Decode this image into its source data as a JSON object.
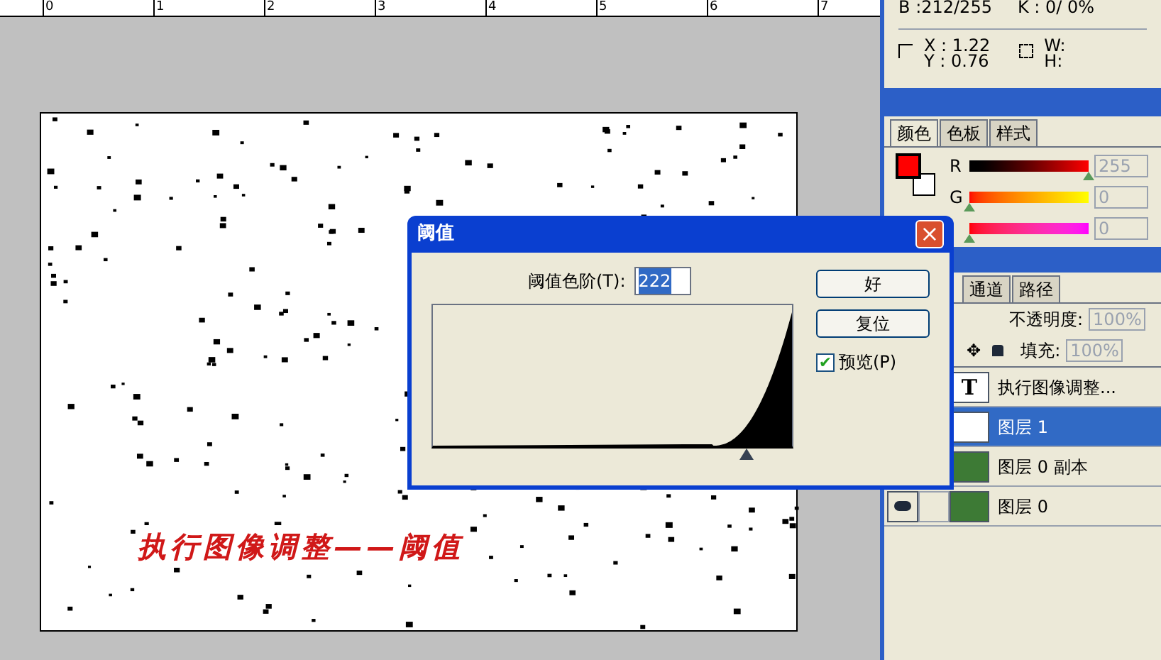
{
  "ruler": {
    "ticks": [
      "0",
      "1",
      "2",
      "3",
      "4",
      "5",
      "6",
      "7"
    ]
  },
  "canvas": {
    "caption": "执行图像调整——阈值"
  },
  "info_panel": {
    "rows": [
      {
        "label": "B",
        "value": ":212/255"
      },
      {
        "label": "K",
        "value": ":  0/  0%"
      }
    ],
    "position": {
      "x_label": "X :",
      "x_value": "1.22",
      "y_label": "Y :",
      "y_value": "0.76",
      "w_label": "W:",
      "h_label": "H:"
    }
  },
  "color_panel": {
    "tabs": [
      {
        "label": "颜色",
        "selected": true
      },
      {
        "label": "色板",
        "selected": false
      },
      {
        "label": "样式",
        "selected": false
      }
    ],
    "sliders": [
      {
        "label": "R",
        "level": 1,
        "value": "255",
        "disabled": true
      },
      {
        "label": "G",
        "level": 0,
        "value": "0",
        "disabled": true
      },
      {
        "level": 0,
        "value": "0",
        "disabled": true
      }
    ]
  },
  "layers_panel": {
    "tabs": [
      {
        "label": "通道",
        "selected": false
      },
      {
        "label": "路径",
        "selected": false
      }
    ],
    "opacity_label": "不透明度:",
    "opacity": "100%",
    "move_glyph": "✥",
    "fill_label": "填充:",
    "fill": "100%",
    "layers": [
      {
        "name": "执行图像调整...",
        "kind": "text",
        "thumb_glyph": "T",
        "selected": false
      },
      {
        "name": "图层 1",
        "kind": "blank",
        "selected": true
      },
      {
        "name": "图层 0 副本",
        "kind": "photo",
        "selected": false
      },
      {
        "name": "图层 0",
        "kind": "photo",
        "selected": false,
        "visible": true
      }
    ]
  },
  "dialog": {
    "title": "阈值",
    "close": "×",
    "level_label": "阈值色阶(T):",
    "level_value": "222",
    "slider": {
      "level": 0.87
    },
    "buttons": [
      "好",
      "复位"
    ],
    "preview": {
      "label": "预览(P)",
      "checked": true,
      "check_glyph": "✔"
    }
  }
}
